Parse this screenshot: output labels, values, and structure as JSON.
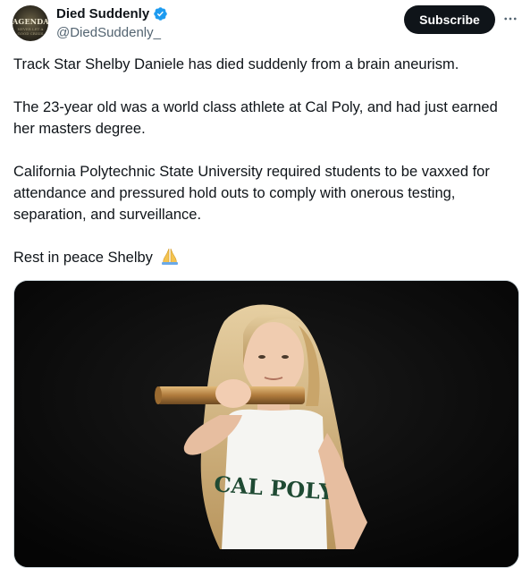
{
  "account": {
    "display_name": "Died Suddenly",
    "handle": "@DiedSuddenly_",
    "avatar_text": "AGENDA",
    "avatar_subtext": "NEVER LET A GOOD CRISIS"
  },
  "header": {
    "subscribe_label": "Subscribe"
  },
  "post": {
    "paragraphs": [
      "Track Star Shelby Daniele has died suddenly from a brain aneurism.",
      "The 23-year old was a world class athlete at Cal Poly, and had just earned her masters degree.",
      "California Polytechnic State University required students to be vaxxed for attendance and pressured hold outs to comply with onerous testing, separation, and surveillance."
    ],
    "closing": "Rest in peace Shelby",
    "closing_emoji": "prayer-hands"
  },
  "media": {
    "jersey_text": "CAL POLY"
  },
  "colors": {
    "verified": "#1d9bf0",
    "subscribe_bg": "#0f1419",
    "secondary_text": "#536471"
  },
  "icons": {
    "verified": "verified-badge-icon",
    "more": "more-options-icon"
  }
}
